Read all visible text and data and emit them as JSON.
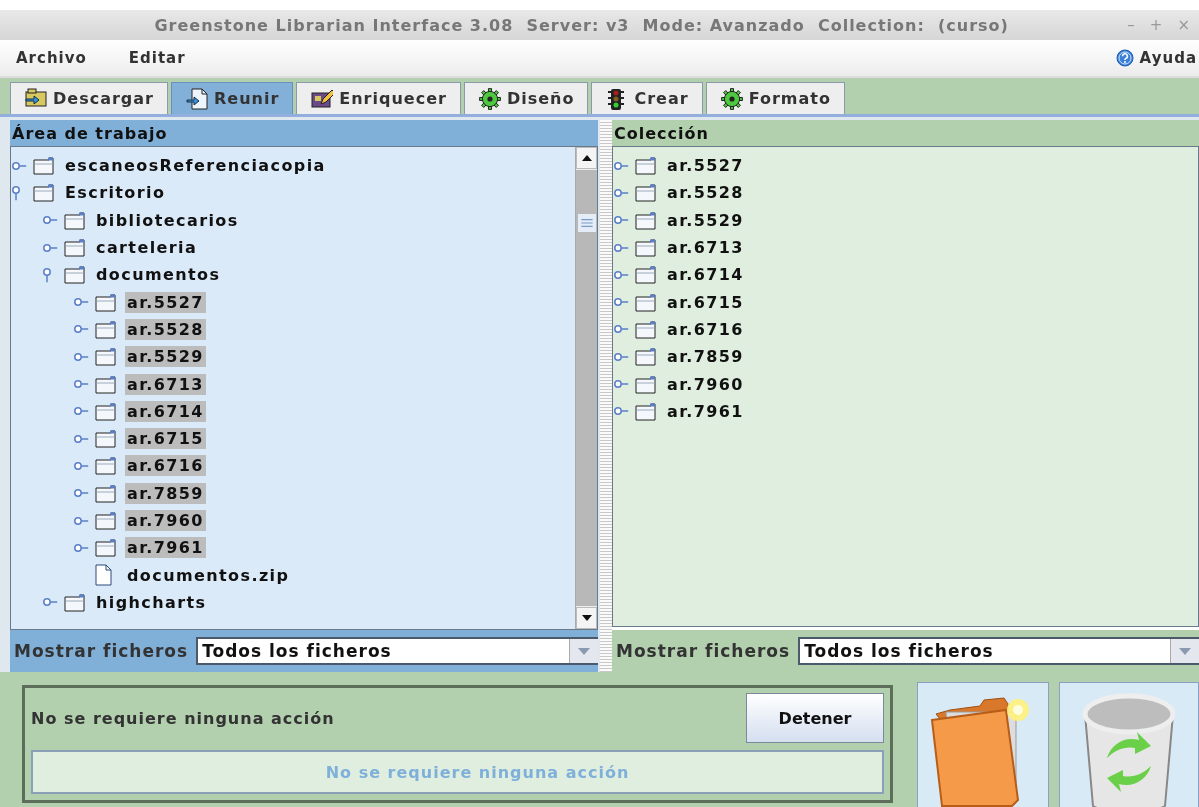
{
  "window": {
    "title": "Greenstone Librarian Interface 3.08  Server: v3  Mode: Avanzado  Collection:  (curso)",
    "controls": [
      "–",
      "+",
      "×"
    ]
  },
  "menu": {
    "items": [
      "Archivo",
      "Editar"
    ],
    "help": "Ayuda"
  },
  "tabs": [
    {
      "label": "Descargar",
      "selected": false
    },
    {
      "label": "Reunir",
      "selected": true
    },
    {
      "label": "Enriquecer",
      "selected": false
    },
    {
      "label": "Diseño",
      "selected": false
    },
    {
      "label": "Crear",
      "selected": false
    },
    {
      "label": "Formato",
      "selected": false
    }
  ],
  "workspace": {
    "title": "Área de trabajo",
    "tree": [
      {
        "label": "escaneosReferenciacopia",
        "kind": "folder",
        "expanded": false,
        "selected": false
      },
      {
        "label": "Escritorio",
        "kind": "folder",
        "expanded": true,
        "selected": false,
        "children": [
          {
            "label": "bibliotecarios",
            "kind": "folder",
            "expanded": false,
            "selected": false
          },
          {
            "label": "carteleria",
            "kind": "folder",
            "expanded": false,
            "selected": false
          },
          {
            "label": "documentos",
            "kind": "folder",
            "expanded": true,
            "selected": false,
            "children": [
              {
                "label": "ar.5527",
                "kind": "folder",
                "expanded": false,
                "selected": true
              },
              {
                "label": "ar.5528",
                "kind": "folder",
                "expanded": false,
                "selected": true
              },
              {
                "label": "ar.5529",
                "kind": "folder",
                "expanded": false,
                "selected": true
              },
              {
                "label": "ar.6713",
                "kind": "folder",
                "expanded": false,
                "selected": true
              },
              {
                "label": "ar.6714",
                "kind": "folder",
                "expanded": false,
                "selected": true
              },
              {
                "label": "ar.6715",
                "kind": "folder",
                "expanded": false,
                "selected": true
              },
              {
                "label": "ar.6716",
                "kind": "folder",
                "expanded": false,
                "selected": true
              },
              {
                "label": "ar.7859",
                "kind": "folder",
                "expanded": false,
                "selected": true
              },
              {
                "label": "ar.7960",
                "kind": "folder",
                "expanded": false,
                "selected": true
              },
              {
                "label": "ar.7961",
                "kind": "folder",
                "expanded": false,
                "selected": true
              },
              {
                "label": "documentos.zip",
                "kind": "file",
                "selected": false
              }
            ]
          },
          {
            "label": "highcharts",
            "kind": "folder",
            "expanded": false,
            "selected": false
          }
        ]
      }
    ],
    "filter": {
      "label": "Mostrar ficheros",
      "value": "Todos los ficheros"
    }
  },
  "collection": {
    "title": "Colección",
    "tree": [
      {
        "label": "ar.5527",
        "kind": "folder",
        "expanded": false,
        "selected": false
      },
      {
        "label": "ar.5528",
        "kind": "folder",
        "expanded": false,
        "selected": false
      },
      {
        "label": "ar.5529",
        "kind": "folder",
        "expanded": false,
        "selected": false
      },
      {
        "label": "ar.6713",
        "kind": "folder",
        "expanded": false,
        "selected": false
      },
      {
        "label": "ar.6714",
        "kind": "folder",
        "expanded": false,
        "selected": false
      },
      {
        "label": "ar.6715",
        "kind": "folder",
        "expanded": false,
        "selected": false
      },
      {
        "label": "ar.6716",
        "kind": "folder",
        "expanded": false,
        "selected": false
      },
      {
        "label": "ar.7859",
        "kind": "folder",
        "expanded": false,
        "selected": false
      },
      {
        "label": "ar.7960",
        "kind": "folder",
        "expanded": false,
        "selected": false
      },
      {
        "label": "ar.7961",
        "kind": "folder",
        "expanded": false,
        "selected": false
      }
    ],
    "filter": {
      "label": "Mostrar ficheros",
      "value": "Todos los ficheros"
    }
  },
  "status": {
    "message": "No se requiere ninguna acción",
    "stop_button": "Detener",
    "progress_text": "No se requiere ninguna acción"
  }
}
